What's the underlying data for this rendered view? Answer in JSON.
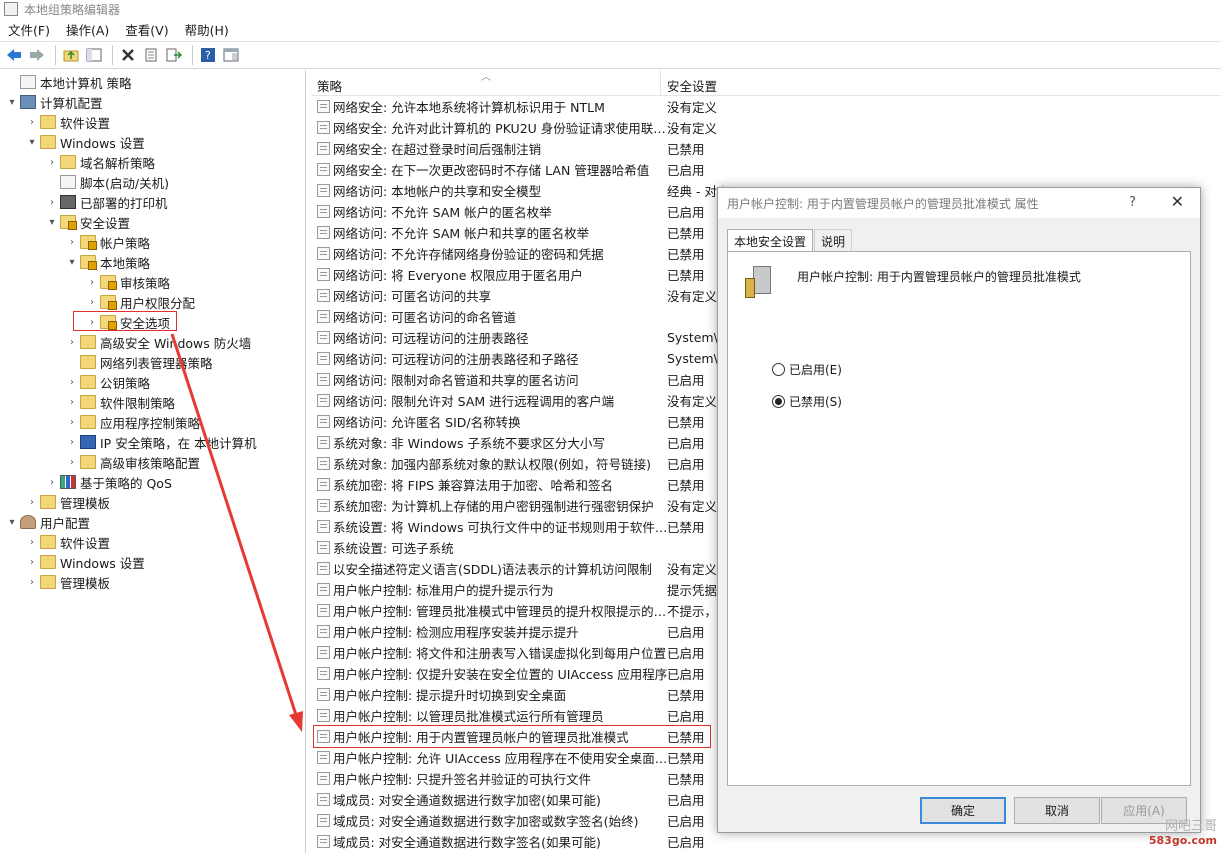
{
  "window": {
    "title": "本地组策略编辑器"
  },
  "menu": [
    "文件(F)",
    "操作(A)",
    "查看(V)",
    "帮助(H)"
  ],
  "toolbar_icons": [
    "back-icon",
    "forward-icon",
    "up-folder-icon",
    "show-hide-tree-icon",
    "delete-icon",
    "properties-icon",
    "export-icon",
    "help-icon",
    "extend-view-icon"
  ],
  "tree": [
    {
      "label": "本地计算机 策略",
      "level": 0,
      "arrow": "",
      "icon": "doc"
    },
    {
      "label": "计算机配置",
      "level": 0,
      "arrow": "▾",
      "icon": "computer"
    },
    {
      "label": "软件设置",
      "level": 1,
      "arrow": "›",
      "icon": "folder"
    },
    {
      "label": "Windows 设置",
      "level": 1,
      "arrow": "▾",
      "icon": "folder"
    },
    {
      "label": "域名解析策略",
      "level": 2,
      "arrow": "›",
      "icon": "folder"
    },
    {
      "label": "脚本(启动/关机)",
      "level": 2,
      "arrow": "",
      "icon": "doc"
    },
    {
      "label": "已部署的打印机",
      "level": 2,
      "arrow": "›",
      "icon": "printer"
    },
    {
      "label": "安全设置",
      "level": 2,
      "arrow": "▾",
      "icon": "folder lock"
    },
    {
      "label": "帐户策略",
      "level": 3,
      "arrow": "›",
      "icon": "folder lock"
    },
    {
      "label": "本地策略",
      "level": 3,
      "arrow": "▾",
      "icon": "folder lock"
    },
    {
      "label": "审核策略",
      "level": 4,
      "arrow": "›",
      "icon": "folder lock"
    },
    {
      "label": "用户权限分配",
      "level": 4,
      "arrow": "›",
      "icon": "folder lock"
    },
    {
      "label": "安全选项",
      "level": 4,
      "arrow": "›",
      "icon": "folder lock"
    },
    {
      "label": "高级安全 Windows 防火墙",
      "level": 3,
      "arrow": "›",
      "icon": "folder"
    },
    {
      "label": "网络列表管理器策略",
      "level": 3,
      "arrow": "",
      "icon": "folder"
    },
    {
      "label": "公钥策略",
      "level": 3,
      "arrow": "›",
      "icon": "folder"
    },
    {
      "label": "软件限制策略",
      "level": 3,
      "arrow": "›",
      "icon": "folder"
    },
    {
      "label": "应用程序控制策略",
      "level": 3,
      "arrow": "›",
      "icon": "folder"
    },
    {
      "label": "IP 安全策略，在 本地计算机",
      "level": 3,
      "arrow": "›",
      "icon": "shield"
    },
    {
      "label": "高级审核策略配置",
      "level": 3,
      "arrow": "›",
      "icon": "folder"
    },
    {
      "label": "基于策略的 QoS",
      "level": 2,
      "arrow": "›",
      "icon": "chart"
    },
    {
      "label": "管理模板",
      "level": 1,
      "arrow": "›",
      "icon": "folder"
    },
    {
      "label": "用户配置",
      "level": 0,
      "arrow": "▾",
      "icon": "user"
    },
    {
      "label": "软件设置",
      "level": 1,
      "arrow": "›",
      "icon": "folder"
    },
    {
      "label": "Windows 设置",
      "level": 1,
      "arrow": "›",
      "icon": "folder"
    },
    {
      "label": "管理模板",
      "level": 1,
      "arrow": "›",
      "icon": "folder"
    }
  ],
  "columns": {
    "policy": "策略",
    "setting": "安全设置"
  },
  "policies": [
    {
      "name": "网络安全: 允许本地系统将计算机标识用于 NTLM",
      "value": "没有定义"
    },
    {
      "name": "网络安全: 允许对此计算机的 PKU2U 身份验证请求使用联…",
      "value": "没有定义"
    },
    {
      "name": "网络安全: 在超过登录时间后强制注销",
      "value": "已禁用"
    },
    {
      "name": "网络安全: 在下一次更改密码时不存储 LAN 管理器哈希值",
      "value": "已启用"
    },
    {
      "name": "网络访问: 本地帐户的共享和安全模型",
      "value": "经典 - 对本地用户进行…"
    },
    {
      "name": "网络访问: 不允许 SAM 帐户的匿名枚举",
      "value": "已启用"
    },
    {
      "name": "网络访问: 不允许 SAM 帐户和共享的匿名枚举",
      "value": "已禁用"
    },
    {
      "name": "网络访问: 不允许存储网络身份验证的密码和凭据",
      "value": "已禁用"
    },
    {
      "name": "网络访问: 将 Everyone 权限应用于匿名用户",
      "value": "已禁用"
    },
    {
      "name": "网络访问: 可匿名访问的共享",
      "value": "没有定义"
    },
    {
      "name": "网络访问: 可匿名访问的命名管道",
      "value": ""
    },
    {
      "name": "网络访问: 可远程访问的注册表路径",
      "value": "System\\C"
    },
    {
      "name": "网络访问: 可远程访问的注册表路径和子路径",
      "value": "System\\C"
    },
    {
      "name": "网络访问: 限制对命名管道和共享的匿名访问",
      "value": "已启用"
    },
    {
      "name": "网络访问: 限制允许对 SAM 进行远程调用的客户端",
      "value": "没有定义"
    },
    {
      "name": "网络访问: 允许匿名 SID/名称转换",
      "value": "已禁用"
    },
    {
      "name": "系统对象: 非 Windows 子系统不要求区分大小写",
      "value": "已启用"
    },
    {
      "name": "系统对象: 加强内部系统对象的默认权限(例如，符号链接)",
      "value": "已启用"
    },
    {
      "name": "系统加密: 将 FIPS 兼容算法用于加密、哈希和签名",
      "value": "已禁用"
    },
    {
      "name": "系统加密: 为计算机上存储的用户密钥强制进行强密钥保护",
      "value": "没有定义"
    },
    {
      "name": "系统设置: 将 Windows 可执行文件中的证书规则用于软件…",
      "value": "已禁用"
    },
    {
      "name": "系统设置: 可选子系统",
      "value": ""
    },
    {
      "name": "以安全描述符定义语言(SDDL)语法表示的计算机访问限制",
      "value": "没有定义"
    },
    {
      "name": "用户帐户控制: 标准用户的提升提示行为",
      "value": "提示凭据"
    },
    {
      "name": "用户帐户控制: 管理员批准模式中管理员的提升权限提示的…",
      "value": "不提示，直"
    },
    {
      "name": "用户帐户控制: 检测应用程序安装并提示提升",
      "value": "已启用"
    },
    {
      "name": "用户帐户控制: 将文件和注册表写入错误虚拟化到每用户位置",
      "value": "已启用"
    },
    {
      "name": "用户帐户控制: 仅提升安装在安全位置的 UIAccess 应用程序",
      "value": "已启用"
    },
    {
      "name": "用户帐户控制: 提示提升时切换到安全桌面",
      "value": "已禁用"
    },
    {
      "name": "用户帐户控制: 以管理员批准模式运行所有管理员",
      "value": "已启用"
    },
    {
      "name": "用户帐户控制: 用于内置管理员帐户的管理员批准模式",
      "value": "已禁用"
    },
    {
      "name": "用户帐户控制: 允许 UIAccess 应用程序在不使用安全桌面…",
      "value": "已禁用"
    },
    {
      "name": "用户帐户控制: 只提升签名并验证的可执行文件",
      "value": "已禁用"
    },
    {
      "name": "域成员: 对安全通道数据进行数字加密(如果可能)",
      "value": "已启用"
    },
    {
      "name": "域成员: 对安全通道数据进行数字加密或数字签名(始终)",
      "value": "已启用"
    },
    {
      "name": "域成员: 对安全通道数据进行数字签名(如果可能)",
      "value": "已启用"
    }
  ],
  "dialog": {
    "title": "用户帐户控制: 用于内置管理员帐户的管理员批准模式 属性",
    "help": "?",
    "close": "✕",
    "tabs": [
      "本地安全设置",
      "说明"
    ],
    "policy_name": "用户帐户控制: 用于内置管理员帐户的管理员批准模式",
    "option_enabled": "已启用(E)",
    "option_disabled": "已禁用(S)",
    "selected": "disabled",
    "ok": "确定",
    "cancel": "取消",
    "apply": "应用(A)"
  },
  "watermark": {
    "line1": "网吧三哥",
    "line2": "583go.com"
  }
}
